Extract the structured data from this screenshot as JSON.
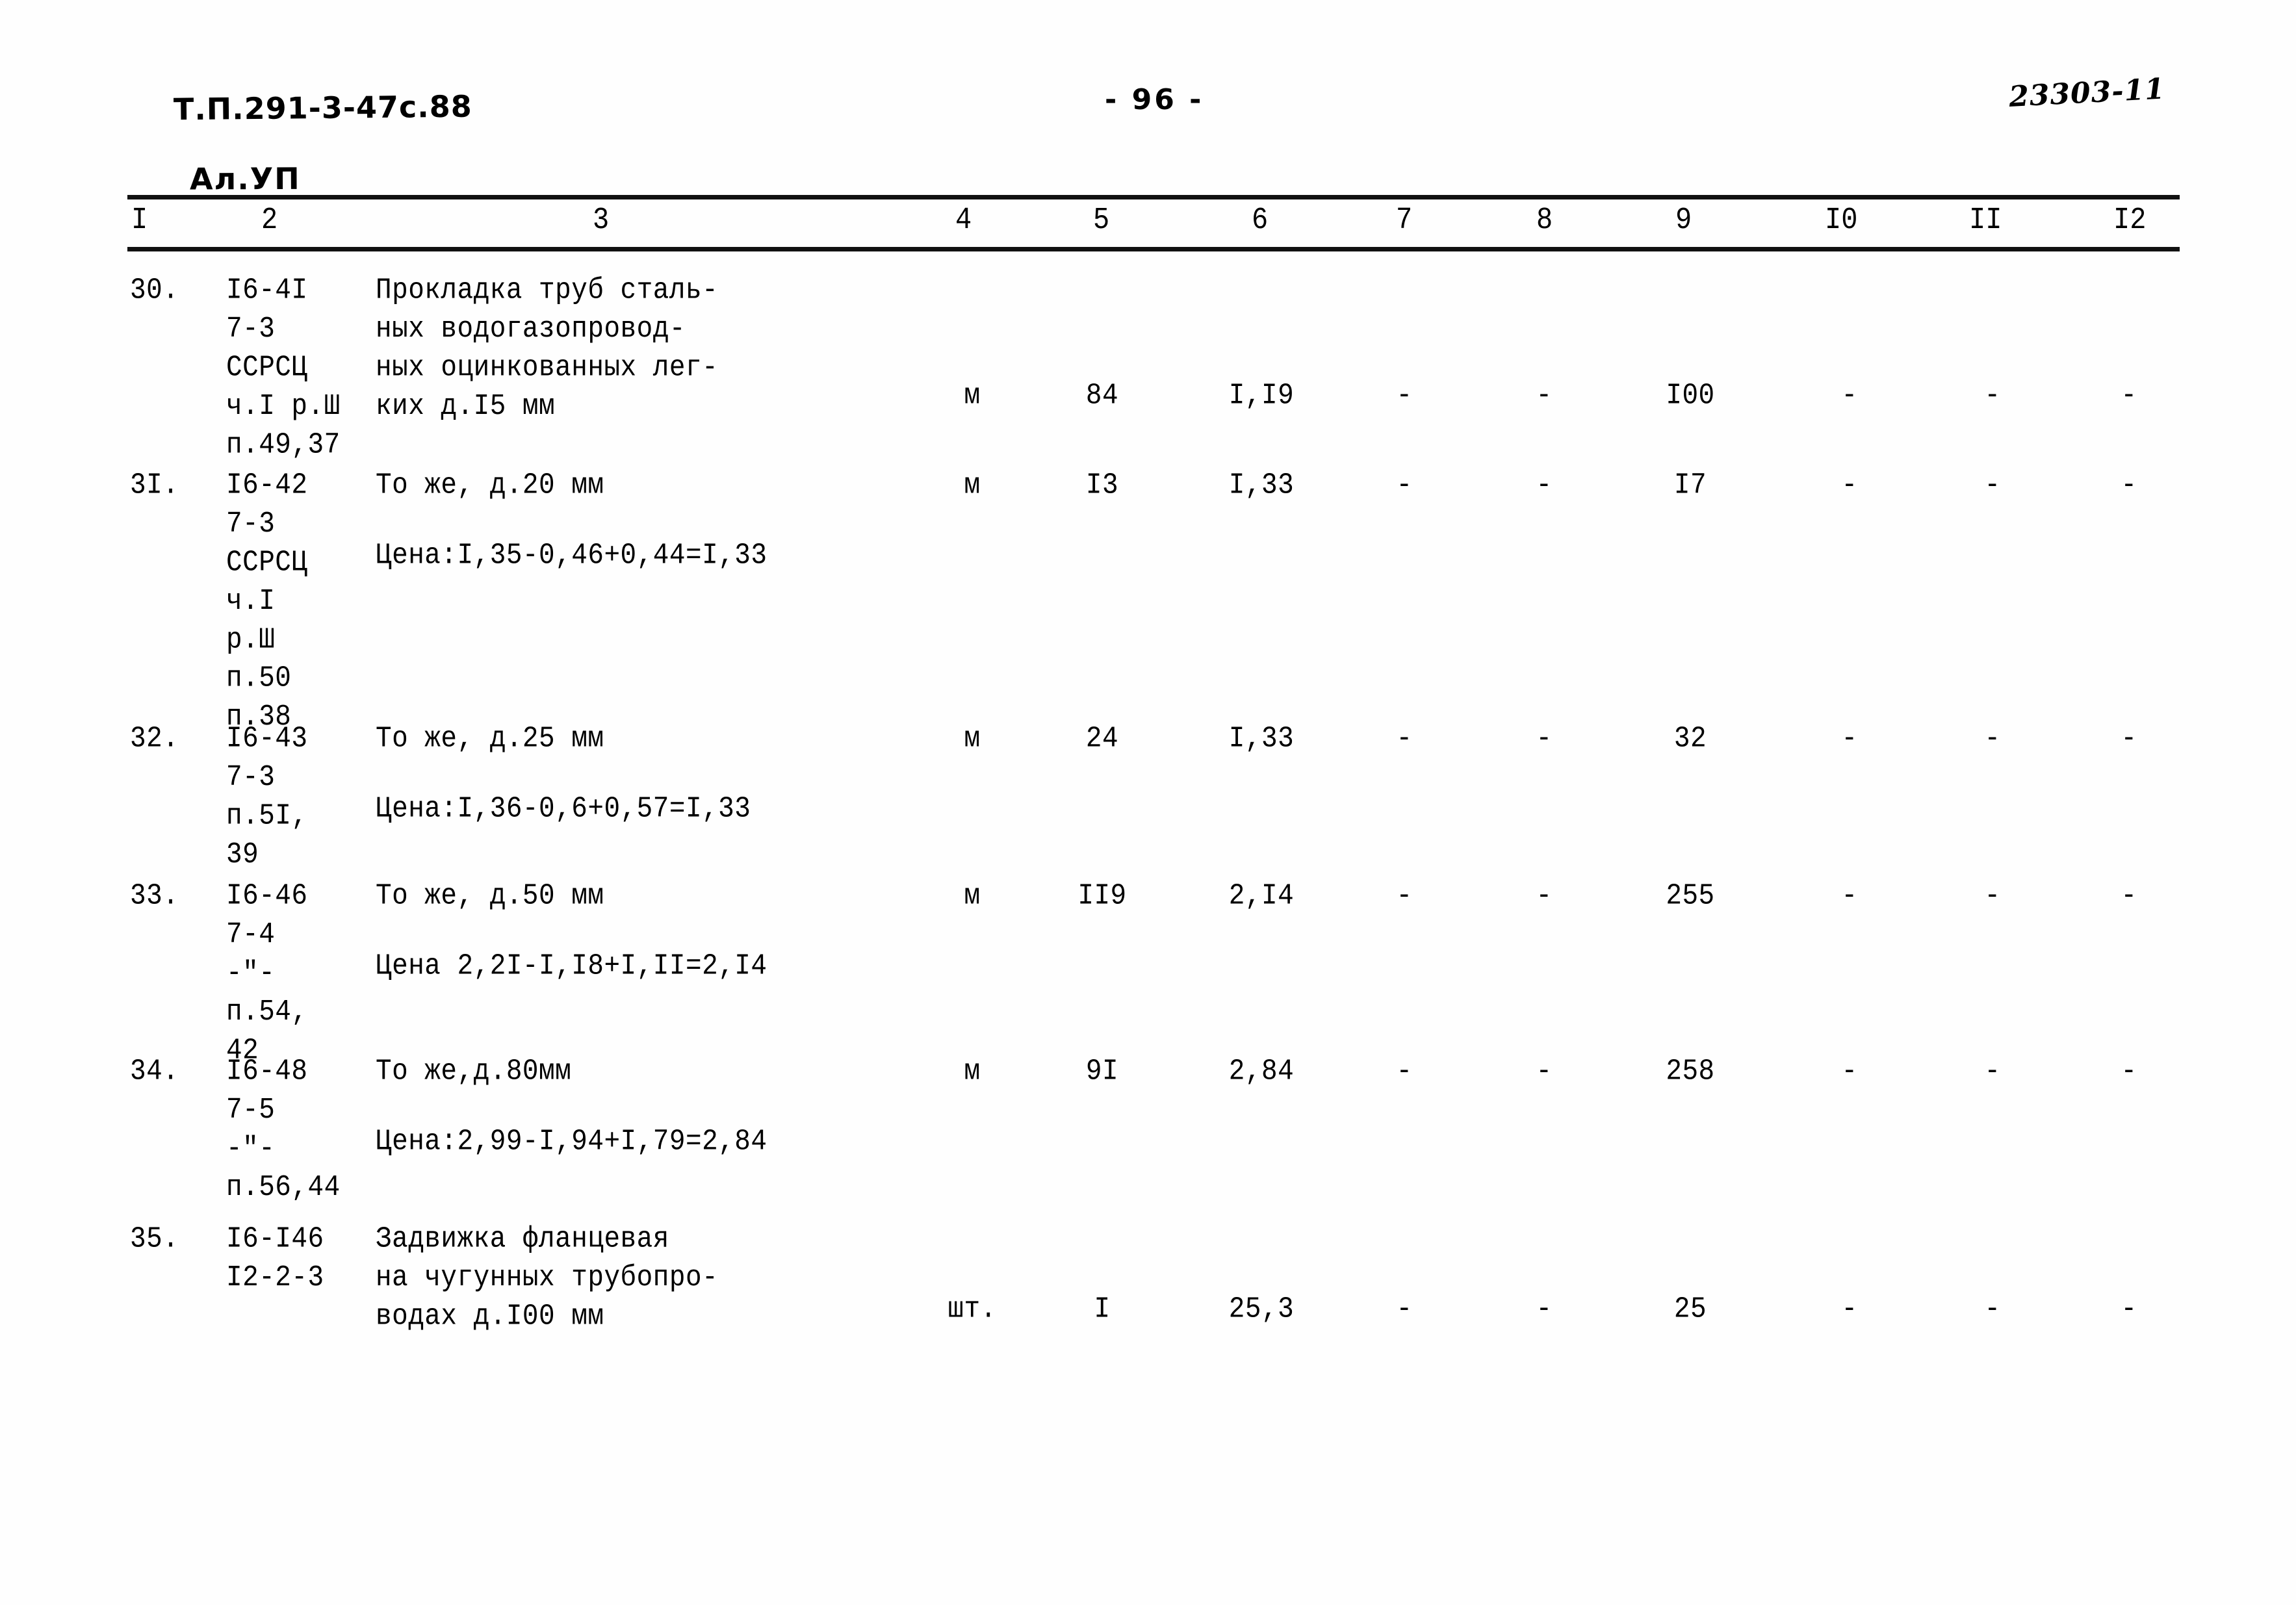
{
  "header": {
    "doc_code_line1": "Т.П.291-3-47с.88",
    "doc_code_line2": "Ал.УП",
    "page_number": "- 96 -",
    "archive_code": "23303-11"
  },
  "table": {
    "column_headers": [
      "I",
      "2",
      "3",
      "4",
      "5",
      "6",
      "7",
      "8",
      "9",
      "I0",
      "II",
      "I2"
    ],
    "rows": [
      {
        "no": "30.",
        "code": "I6-4I\n7-3\nССРСЦ\nч.I р.Ш\nп.49,37",
        "name": "Прокладка труб сталь-\nных водогазопровод-\nных оцинкованных лег-\nких д.I5 мм",
        "unit": "м",
        "qty": "84",
        "price": "I,I9",
        "c7": "-",
        "c8": "-",
        "total": "I00",
        "c10": "-",
        "c11": "-",
        "c12": "-"
      },
      {
        "no": "3I.",
        "code": "I6-42\n7-3\nССРСЦ\nч.I\nр.Ш\nп.50\nп.38",
        "name": "То же, д.20 мм",
        "note": "Цена:I,35-0,46+0,44=I,33",
        "unit": "м",
        "qty": "I3",
        "price": "I,33",
        "c7": "-",
        "c8": "-",
        "total": "I7",
        "c10": "-",
        "c11": "-",
        "c12": "-"
      },
      {
        "no": "32.",
        "code": "I6-43\n7-3\nп.5I,\n39",
        "name": "То же, д.25 мм",
        "note": "Цена:I,36-0,6+0,57=I,33",
        "unit": "м",
        "qty": "24",
        "price": "I,33",
        "c7": "-",
        "c8": "-",
        "total": "32",
        "c10": "-",
        "c11": "-",
        "c12": "-"
      },
      {
        "no": "33.",
        "code": "I6-46\n7-4\n-\"-\nп.54,\n42",
        "name": "То же, д.50 мм",
        "note": "Цена 2,2I-I,I8+I,II=2,I4",
        "unit": "м",
        "qty": "II9",
        "price": "2,I4",
        "c7": "-",
        "c8": "-",
        "total": "255",
        "c10": "-",
        "c11": "-",
        "c12": "-"
      },
      {
        "no": "34.",
        "code": "I6-48\n7-5\n-\"-\nп.56,44",
        "name": "То же,д.80мм",
        "note": "Цена:2,99-I,94+I,79=2,84",
        "unit": "м",
        "qty": "9I",
        "price": "2,84",
        "c7": "-",
        "c8": "-",
        "total": "258",
        "c10": "-",
        "c11": "-",
        "c12": "-"
      },
      {
        "no": "35.",
        "code": "I6-I46\nI2-2-3",
        "name": "Задвижка фланцевая\nна чугунных трубопро-\nводах д.I00 мм",
        "unit": "шт.",
        "qty": "I",
        "price": "25,3",
        "c7": "-",
        "c8": "-",
        "total": "25",
        "c10": "-",
        "c11": "-",
        "c12": "-"
      }
    ]
  }
}
